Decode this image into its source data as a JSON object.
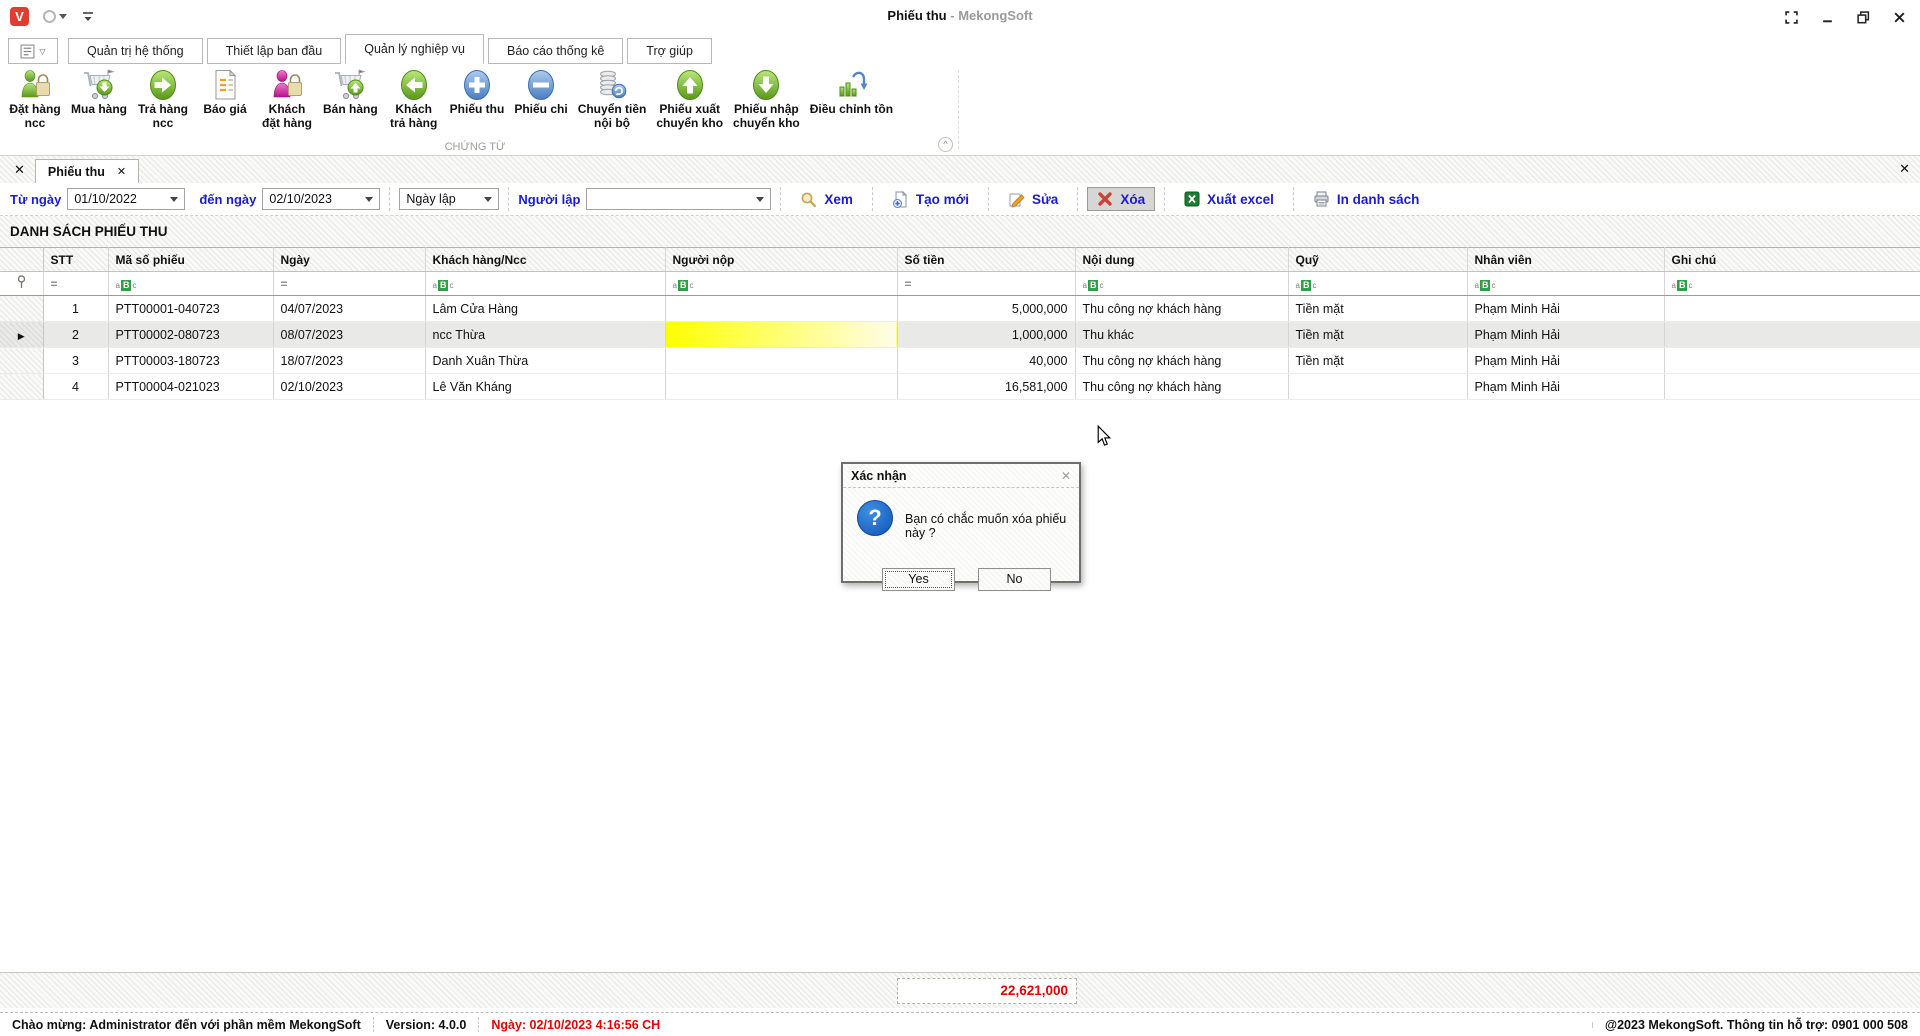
{
  "window": {
    "title_primary": "Phiếu thu",
    "title_secondary": "- MekongSoft"
  },
  "menu": {
    "tabs": [
      {
        "label": "Quản trị hệ thống"
      },
      {
        "label": "Thiết lập ban đầu"
      },
      {
        "label": "Quản lý nghiệp vụ"
      },
      {
        "label": "Báo cáo thống kê"
      },
      {
        "label": "Trợ giúp"
      }
    ]
  },
  "ribbon": {
    "group_label": "CHỨNG TỪ",
    "items": [
      {
        "label": "Đặt hàng\nncc",
        "icon": "person-bag-green"
      },
      {
        "label": "Mua hàng",
        "icon": "cart-arrow-down"
      },
      {
        "label": "Trả hàng\nncc",
        "icon": "oval-arrow-right"
      },
      {
        "label": "Báo giá",
        "icon": "document"
      },
      {
        "label": "Khách\nđặt hàng",
        "icon": "person-bag-pink"
      },
      {
        "label": "Bán hàng",
        "icon": "cart-arrow-up"
      },
      {
        "label": "Khách\ntrả hàng",
        "icon": "oval-arrow-left"
      },
      {
        "label": "Phiếu thu",
        "icon": "oval-plus-blue"
      },
      {
        "label": "Phiếu chi",
        "icon": "oval-minus-blue"
      },
      {
        "label": "Chuyển tiền\nnội bộ",
        "icon": "coins-transfer"
      },
      {
        "label": "Phiếu xuất\nchuyển kho",
        "icon": "oval-arrow-up"
      },
      {
        "label": "Phiếu nhập\nchuyển kho",
        "icon": "oval-arrow-down"
      },
      {
        "label": "Điều chỉnh tồn",
        "icon": "chart-adjust"
      }
    ]
  },
  "doc_tabs": {
    "active_label": "Phiếu thu"
  },
  "filter_bar": {
    "from_label": "Từ ngày",
    "from_value": "01/10/2022",
    "to_label": "đến ngày",
    "to_value": "02/10/2023",
    "date_type_value": "Ngày lập",
    "creator_label": "Người lập",
    "creator_value": "",
    "buttons": {
      "xem": "Xem",
      "tao_moi": "Tạo mới",
      "sua": "Sửa",
      "xoa": "Xóa",
      "xuat_excel": "Xuất excel",
      "in_danh_sach": "In danh sách"
    }
  },
  "list": {
    "title": "DANH SÁCH PHIẾU THU",
    "columns": [
      "STT",
      "Mã số phiếu",
      "Ngày",
      "Khách hàng/Ncc",
      "Người nộp",
      "Số tiền",
      "Nội dung",
      "Quỹ",
      "Nhân viên",
      "Ghi chú"
    ],
    "rows": [
      {
        "stt": "1",
        "code": "PTT00001-040723",
        "date": "04/07/2023",
        "customer": "Lâm Cửa Hàng",
        "payer": "",
        "amount": "5,000,000",
        "content": "Thu công nợ khách hàng",
        "fund": "Tiền mặt",
        "employee": "Phạm Minh Hải",
        "note": ""
      },
      {
        "stt": "2",
        "code": "PTT00002-080723",
        "date": "08/07/2023",
        "customer": "ncc Thừa",
        "payer": "",
        "amount": "1,000,000",
        "content": "Thu khác",
        "fund": "Tiền mặt",
        "employee": "Phạm Minh Hải",
        "note": ""
      },
      {
        "stt": "3",
        "code": "PTT00003-180723",
        "date": "18/07/2023",
        "customer": "Danh Xuân Thừa",
        "payer": "",
        "amount": "40,000",
        "content": "Thu công nợ khách hàng",
        "fund": "Tiền mặt",
        "employee": "Phạm Minh Hải",
        "note": ""
      },
      {
        "stt": "4",
        "code": "PTT00004-021023",
        "date": "02/10/2023",
        "customer": "Lê Văn Kháng",
        "payer": "",
        "amount": "16,581,000",
        "content": "Thu công nợ khách hàng",
        "fund": "",
        "employee": "Phạm Minh Hải",
        "note": ""
      }
    ],
    "total_amount": "22,621,000"
  },
  "dialog": {
    "title": "Xác nhận",
    "message": "Bạn có chắc muốn xóa phiếu này ?",
    "yes_label": "Yes",
    "no_label": "No"
  },
  "status_bar": {
    "welcome": "Chào mừng: Administrator đến với phần mềm MekongSoft",
    "version": "Version: 4.0.0",
    "date": "Ngày: 02/10/2023 4:16:56 CH",
    "support": "@2023 MekongSoft. Thông tin hỗ trợ: 0901 000 508"
  },
  "colors": {
    "accent_blue_text": "#1b1bd0",
    "total_red": "#e60000",
    "abc_filter_green": "#2f9e44",
    "highlight_yellow": "#ffff00"
  }
}
